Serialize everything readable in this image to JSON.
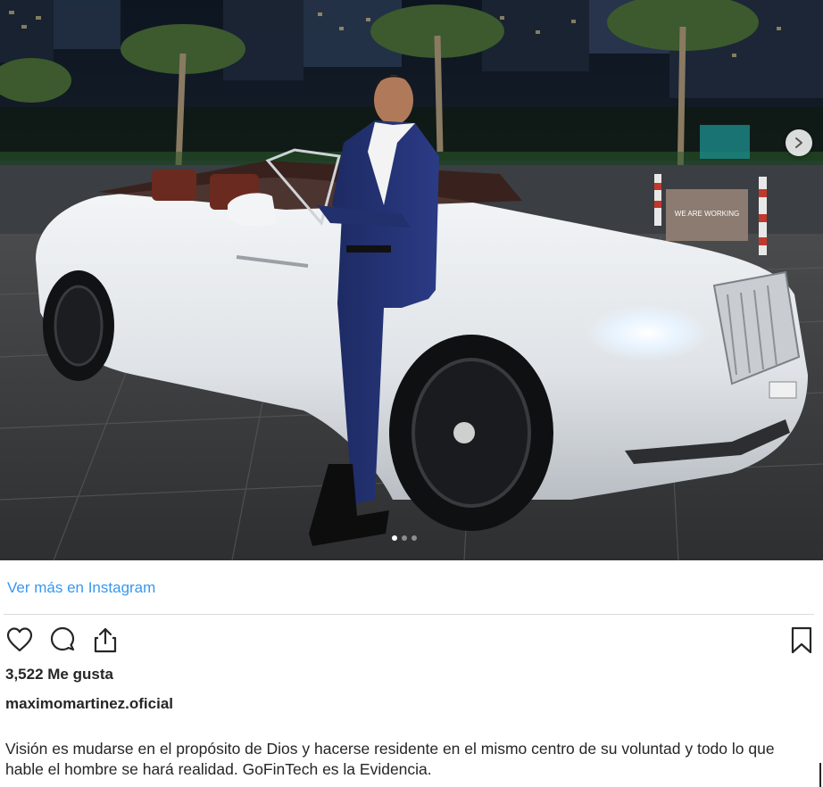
{
  "post": {
    "photo_alt": "Hombre de traje azul apoyado en un Rolls-Royce descapotable blanco de noche",
    "sign_text": "WE ARE WORKING",
    "carousel_count": 3,
    "carousel_active": 1
  },
  "view_more_label": "Ver más en Instagram",
  "actions": {
    "like_icon": "heart-outline",
    "comment_icon": "speech-bubble",
    "share_icon": "share-upload",
    "save_icon": "bookmark-outline"
  },
  "likes_text": "3,522 Me gusta",
  "username": "maximomartinez.oficial",
  "caption": "Visión es mudarse en el propósito de Dios y hacerse residente en el mismo centro de su voluntad y todo lo que hable el hombre se hará realidad. GoFinTech es la Evidencia.",
  "colors": {
    "link": "#3897f0",
    "text": "#262626",
    "divider": "#dbdbdb"
  }
}
